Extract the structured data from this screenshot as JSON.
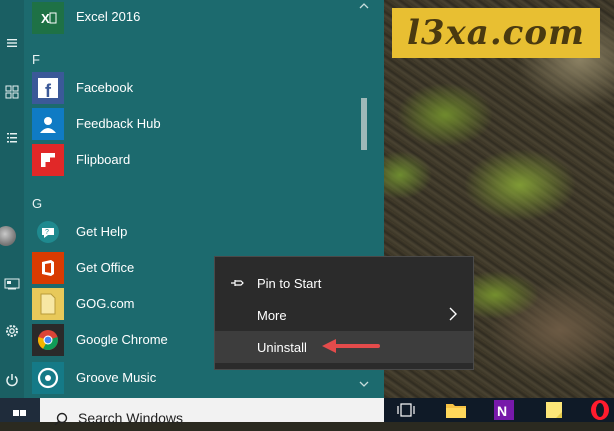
{
  "watermark": {
    "text": "l3xa.com"
  },
  "start_menu": {
    "rail_icons": [
      "hamburger-icon",
      "tiles-icon",
      "list-icon",
      "user-avatar",
      "media-icon",
      "gear-icon",
      "power-icon"
    ],
    "sections": [
      {
        "letter": "F"
      },
      {
        "letter": "G"
      }
    ],
    "apps": [
      {
        "name": "Excel 2016",
        "tile_color": "#1e7145",
        "glyph": "X"
      },
      {
        "name": "Facebook",
        "tile_color": "#3b5998",
        "glyph": "f"
      },
      {
        "name": "Feedback Hub",
        "tile_color": "#0f7bc4",
        "glyph": ""
      },
      {
        "name": "Flipboard",
        "tile_color": "#e12828",
        "glyph": ""
      },
      {
        "name": "Get Help",
        "tile_color": "#1b6e73",
        "glyph": ""
      },
      {
        "name": "Get Office",
        "tile_color": "#d83b01",
        "glyph": ""
      },
      {
        "name": "GOG.com",
        "tile_color": "#e8c95a",
        "glyph": ""
      },
      {
        "name": "Google Chrome",
        "tile_color": "#2a2a2a",
        "glyph": ""
      },
      {
        "name": "Groove Music",
        "tile_color": "#157a87",
        "glyph": ""
      }
    ]
  },
  "context_menu": {
    "items": [
      {
        "label": "Pin to Start"
      },
      {
        "label": "More"
      },
      {
        "label": "Uninstall"
      }
    ]
  },
  "taskbar": {
    "search_placeholder": "Search Windows"
  },
  "colors": {
    "start_bg": "#1c6a6e",
    "taskbar_bg": "#0f1a27",
    "context_bg": "#2b2b2b",
    "arrow": "#e44b4b",
    "watermark_bg": "#e8bf32"
  }
}
